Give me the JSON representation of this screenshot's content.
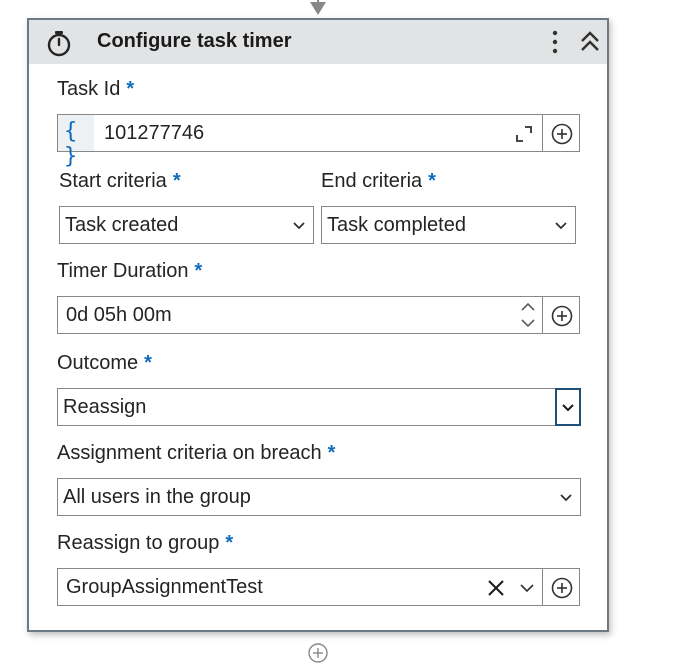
{
  "header": {
    "title": "Configure task timer",
    "icon": "stopwatch-icon"
  },
  "task_id": {
    "label": "Task Id",
    "required_mark": "*",
    "prefix_icon": "{ }",
    "value": "101277746"
  },
  "start_criteria": {
    "label": "Start criteria",
    "required_mark": "*",
    "value": "Task created"
  },
  "end_criteria": {
    "label": "End criteria",
    "required_mark": "*",
    "value": "Task completed"
  },
  "timer_duration": {
    "label": "Timer Duration",
    "required_mark": "*",
    "value": "0d 05h 00m"
  },
  "outcome": {
    "label": "Outcome",
    "required_mark": "*",
    "value": "Reassign"
  },
  "assignment_criteria": {
    "label": "Assignment criteria on breach",
    "required_mark": "*",
    "value": "All users in the group"
  },
  "reassign_group": {
    "label": "Reassign to group",
    "required_mark": "*",
    "value": "GroupAssignmentTest"
  },
  "colors": {
    "accent": "#0f6cbd",
    "header_bg": "#e1e3e5",
    "border": "#8a8886",
    "focus_border": "#1f4e79"
  }
}
